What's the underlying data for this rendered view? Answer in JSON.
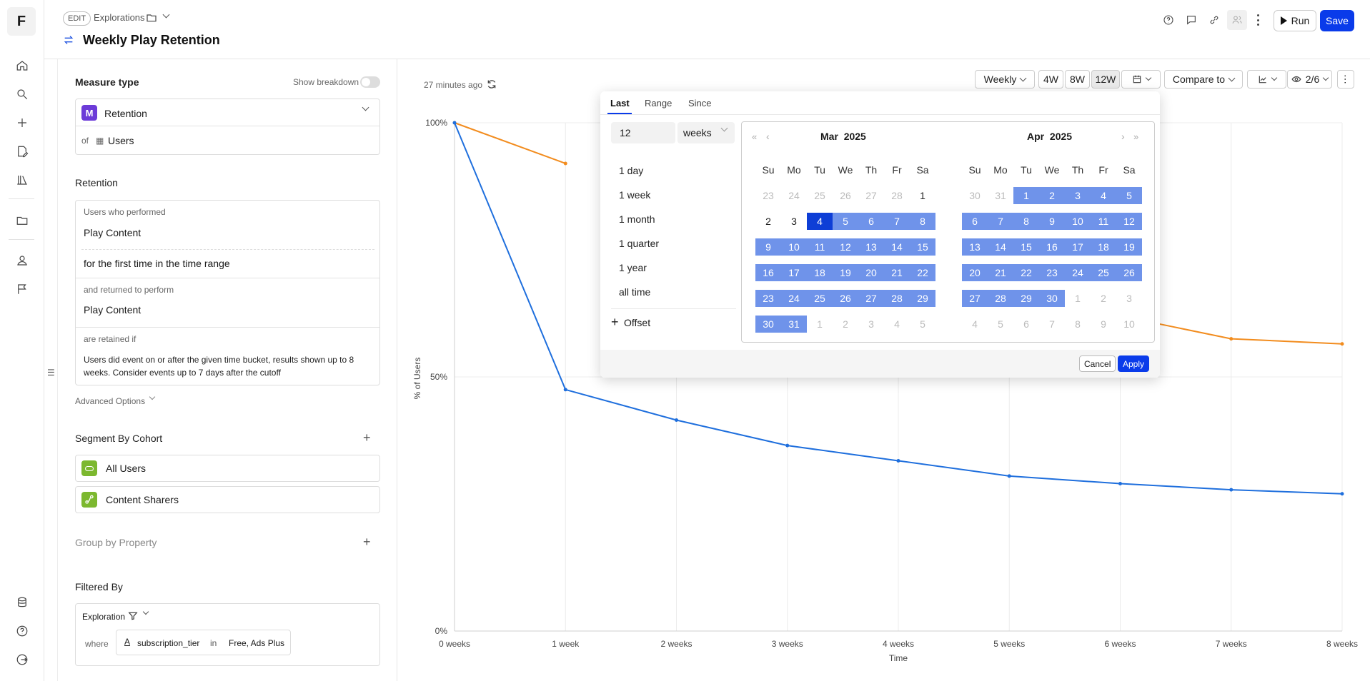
{
  "app": {
    "logo_letter": "F"
  },
  "header": {
    "edit_label": "EDIT",
    "breadcrumb": "Explorations",
    "title": "Weekly Play Retention",
    "run_label": "Run",
    "save_label": "Save"
  },
  "panel": {
    "measure_type_title": "Measure type",
    "show_breakdown": "Show breakdown",
    "measure_badge": "M",
    "measure_value": "Retention",
    "of_label": "of",
    "of_value": "Users",
    "retention_title": "Retention",
    "users_performed_label": "Users who performed",
    "first_event": "Play Content",
    "first_time_text": "for the first time in the time range",
    "returned_label": "and returned to perform",
    "return_event": "Play Content",
    "retained_if_label": "are retained if",
    "retained_if_text": "Users did event on or after the given time bucket, results shown up to 8 weeks. Consider events up to 7 days after the cutoff",
    "advanced_options": "Advanced Options",
    "segment_title": "Segment By Cohort",
    "cohorts": [
      "All Users",
      "Content Sharers"
    ],
    "group_by_title": "Group by Property",
    "filtered_by_title": "Filtered By",
    "filter_scope": "Exploration",
    "where_label": "where",
    "filter_property": "subscription_tier",
    "filter_op": "in",
    "filter_values": "Free, Ads Plus"
  },
  "toolbar": {
    "updated": "27 minutes ago",
    "granularity": "Weekly",
    "quick_ranges": [
      "4W",
      "8W",
      "12W"
    ],
    "active_range": "12W",
    "compare_to": "Compare to",
    "visible_series": "2/6"
  },
  "popover": {
    "tabs": [
      "Last",
      "Range",
      "Since"
    ],
    "active_tab": "Last",
    "count_value": "12",
    "unit_value": "weeks",
    "options": [
      "1 day",
      "1 week",
      "1 month",
      "1 quarter",
      "1 year",
      "all time"
    ],
    "offset_label": "Offset",
    "cancel_label": "Cancel",
    "apply_label": "Apply",
    "weekdays": [
      "Su",
      "Mo",
      "Tu",
      "We",
      "Th",
      "Fr",
      "Sa"
    ],
    "months": [
      {
        "month": "Mar",
        "year": "2025",
        "weeks": [
          [
            "23",
            "24",
            "25",
            "26",
            "27",
            "28",
            "1"
          ],
          [
            "2",
            "3",
            "4",
            "5",
            "6",
            "7",
            "8"
          ],
          [
            "9",
            "10",
            "11",
            "12",
            "13",
            "14",
            "15"
          ],
          [
            "16",
            "17",
            "18",
            "19",
            "20",
            "21",
            "22"
          ],
          [
            "23",
            "24",
            "25",
            "26",
            "27",
            "28",
            "29"
          ],
          [
            "30",
            "31",
            "1",
            "2",
            "3",
            "4",
            "5"
          ]
        ]
      },
      {
        "month": "Apr",
        "year": "2025",
        "weeks": [
          [
            "30",
            "31",
            "1",
            "2",
            "3",
            "4",
            "5"
          ],
          [
            "6",
            "7",
            "8",
            "9",
            "10",
            "11",
            "12"
          ],
          [
            "13",
            "14",
            "15",
            "16",
            "17",
            "18",
            "19"
          ],
          [
            "20",
            "21",
            "22",
            "23",
            "24",
            "25",
            "26"
          ],
          [
            "27",
            "28",
            "29",
            "30",
            "1",
            "2",
            "3"
          ],
          [
            "4",
            "5",
            "6",
            "7",
            "8",
            "9",
            "10"
          ]
        ]
      }
    ],
    "range_start": "2025-03-04",
    "range_end": "2025-04-30"
  },
  "chart_data": {
    "type": "line",
    "xlabel": "Time",
    "ylabel": "% of Users",
    "x": [
      "0 weeks",
      "1 week",
      "2 weeks",
      "3 weeks",
      "4 weeks",
      "5 weeks",
      "6 weeks",
      "7 weeks",
      "8 weeks"
    ],
    "y_ticks": [
      "0%",
      "50%",
      "100%"
    ],
    "ylim": [
      0,
      100
    ],
    "grid": true,
    "series": [
      {
        "color": "#f28c1e",
        "values": [
          100,
          92,
          null,
          null,
          null,
          null,
          62,
          57.5,
          56.5
        ]
      },
      {
        "color": "#1f6fdd",
        "values": [
          100,
          47.5,
          41.5,
          36.5,
          33.5,
          30.5,
          29,
          27.8,
          27
        ]
      }
    ]
  }
}
